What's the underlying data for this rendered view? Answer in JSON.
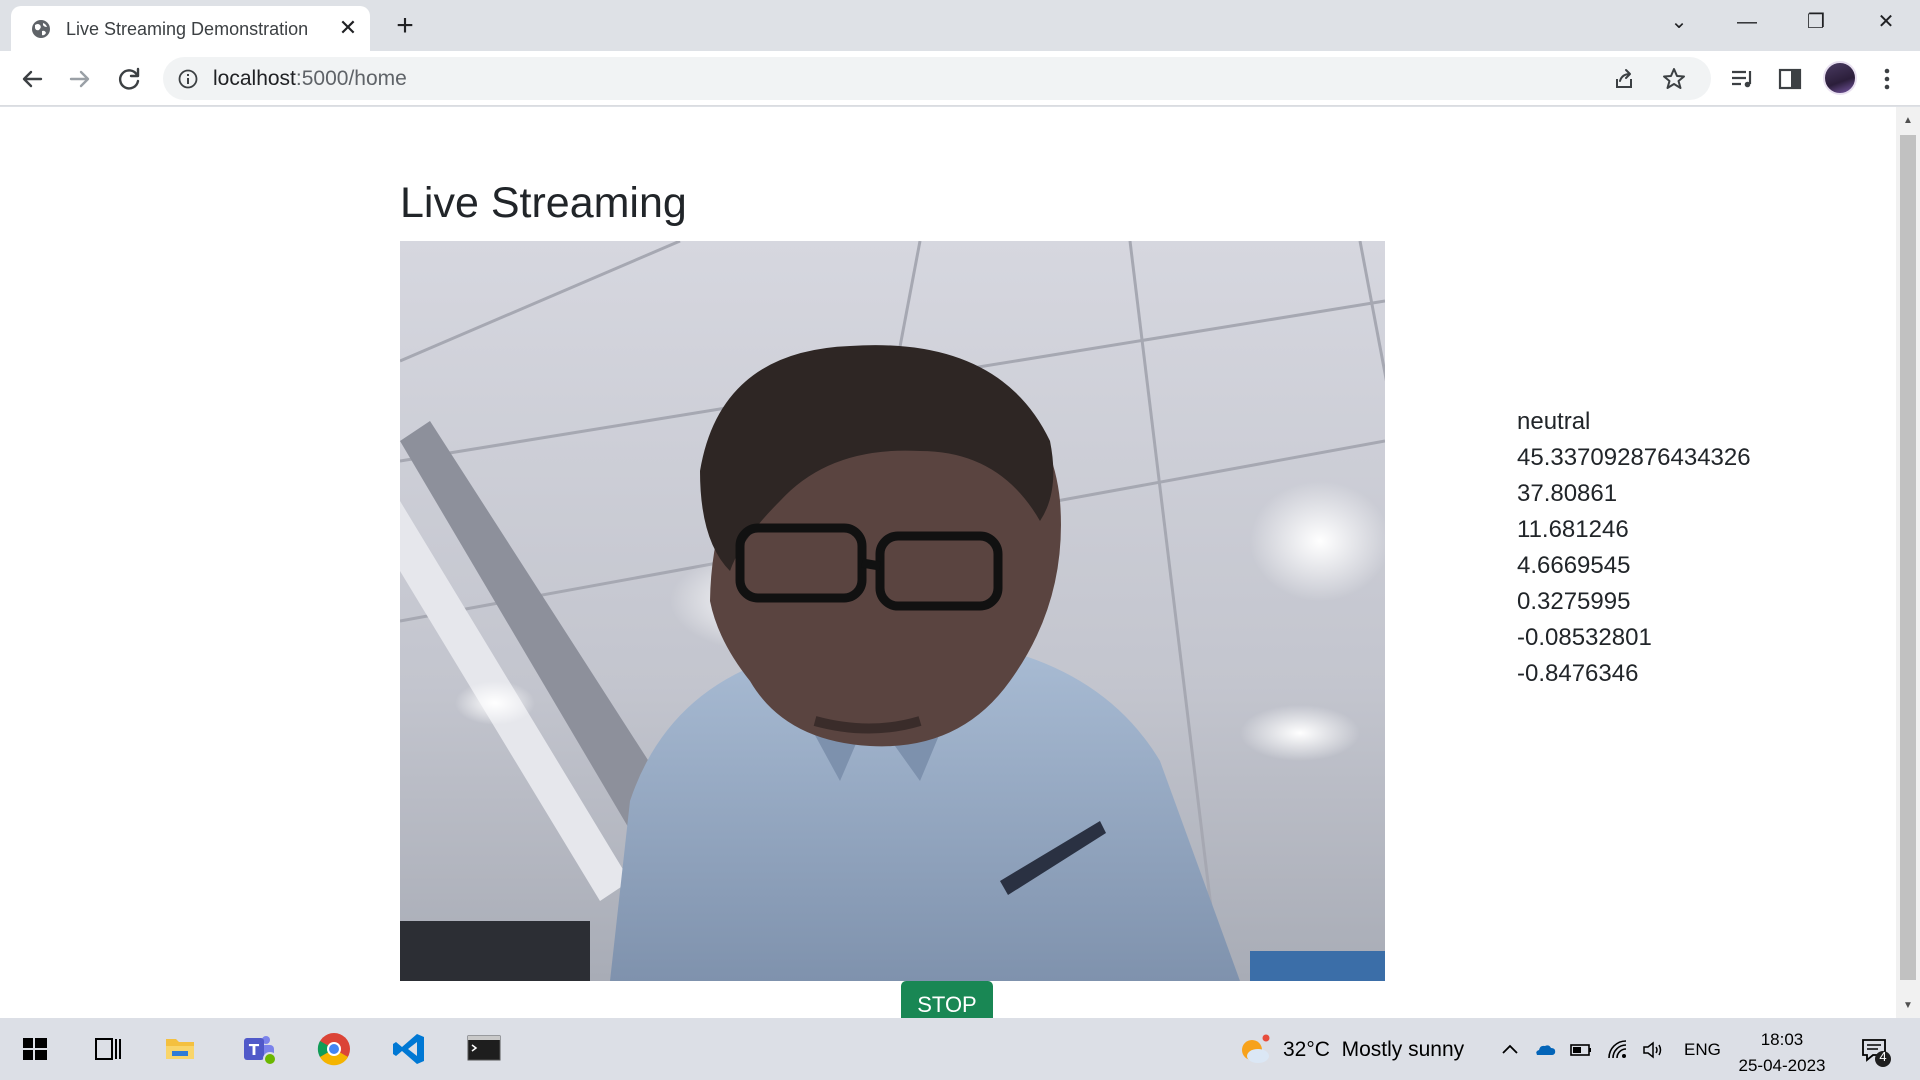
{
  "browser": {
    "tab_title": "Live Streaming Demonstration",
    "tab_close": "✕",
    "new_tab": "+",
    "url_host": "localhost",
    "url_rest": ":5000/home",
    "window_controls": {
      "tabsearch": "⌄",
      "minimize": "—",
      "restore": "❐",
      "close": "✕"
    }
  },
  "page": {
    "heading": "Live Streaming",
    "video_alt": "webcam live stream",
    "emotion": "neutral",
    "scores": [
      "45.337092876434326",
      "37.80861",
      "11.681246",
      "4.6669545",
      "0.3275995",
      "-0.08532801",
      "-0.8476346"
    ],
    "stop_label": "STOP",
    "stop_color": "#198754"
  },
  "taskbar": {
    "weather_temp": "32°C",
    "weather_desc": "Mostly sunny",
    "language": "ENG",
    "time": "18:03",
    "date": "25-04-2023",
    "notification_count": "4",
    "apps": [
      "start-icon",
      "task-view-icon",
      "file-explorer-icon",
      "teams-icon",
      "chrome-icon",
      "vscode-icon",
      "terminal-icon"
    ]
  }
}
